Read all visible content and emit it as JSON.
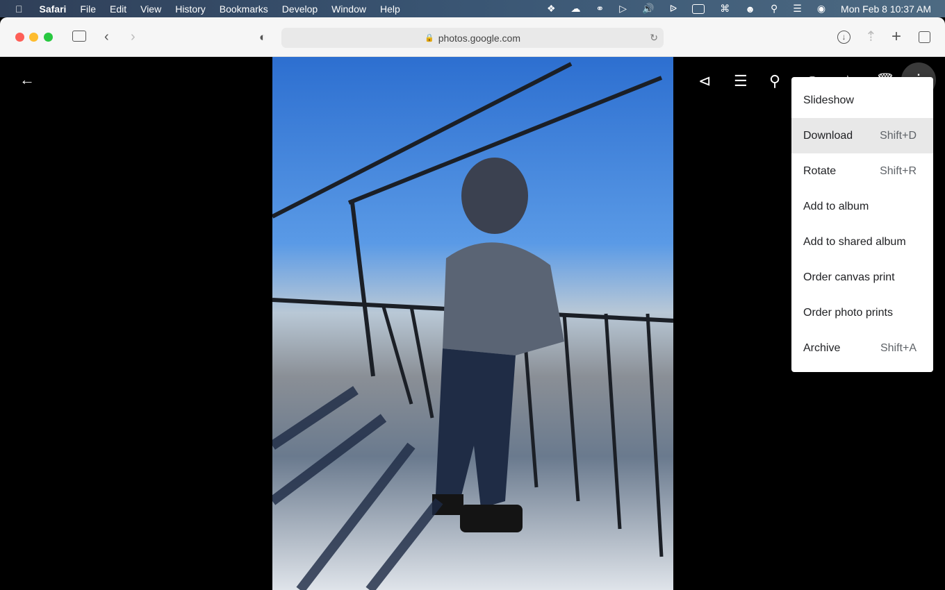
{
  "menubar": {
    "app": "Safari",
    "items": [
      "File",
      "Edit",
      "View",
      "History",
      "Bookmarks",
      "Develop",
      "Window",
      "Help"
    ],
    "clock": "Mon Feb 8  10:37 AM"
  },
  "browser": {
    "url": "photos.google.com"
  },
  "viewer": {
    "photo_description_alt": "Photo"
  },
  "menu": {
    "items": [
      {
        "label": "Slideshow",
        "shortcut": ""
      },
      {
        "label": "Download",
        "shortcut": "Shift+D",
        "highlighted": true
      },
      {
        "label": "Rotate",
        "shortcut": "Shift+R"
      },
      {
        "label": "Add to album",
        "shortcut": ""
      },
      {
        "label": "Add to shared album",
        "shortcut": ""
      },
      {
        "label": "Order canvas print",
        "shortcut": ""
      },
      {
        "label": "Order photo prints",
        "shortcut": ""
      },
      {
        "label": "Archive",
        "shortcut": "Shift+A"
      }
    ]
  }
}
